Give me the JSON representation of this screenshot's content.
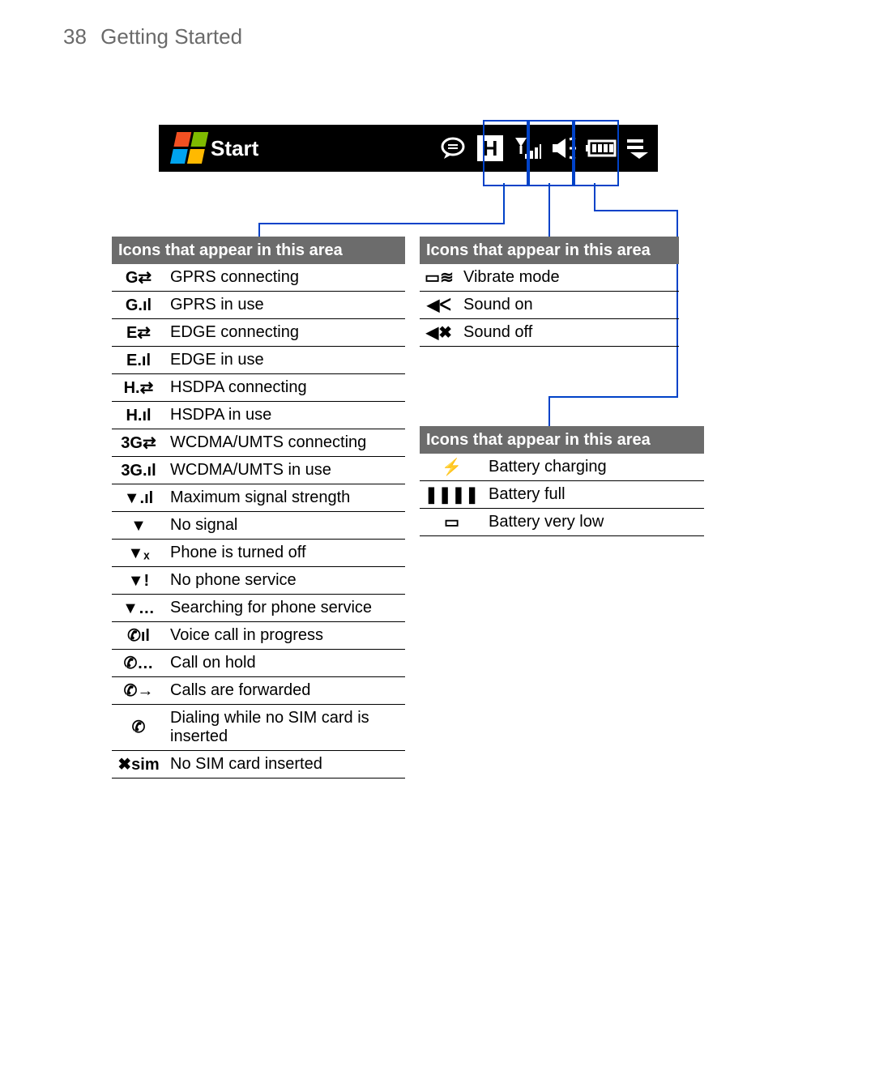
{
  "header": {
    "page_number": "38",
    "section": "Getting Started"
  },
  "statusbar": {
    "start_label": "Start",
    "icons": [
      "chat-icon",
      "hsdpa-icon",
      "signal-icon",
      "sound-icon",
      "battery-icon",
      "menu-icon"
    ]
  },
  "callout": {
    "blue": "#0042c8"
  },
  "tables": {
    "signal": {
      "title": "Icons that appear in this area",
      "rows": [
        {
          "icon": "G⇄",
          "label": "GPRS connecting"
        },
        {
          "icon": "G.ıl",
          "label": "GPRS in use"
        },
        {
          "icon": "E⇄",
          "label": "EDGE connecting"
        },
        {
          "icon": "E.ıl",
          "label": "EDGE in use"
        },
        {
          "icon": "H.⇄",
          "label": "HSDPA connecting"
        },
        {
          "icon": "H.ıl",
          "label": "HSDPA in use"
        },
        {
          "icon": "3G⇄",
          "label": "WCDMA/UMTS connecting"
        },
        {
          "icon": "3G.ıl",
          "label": "WCDMA/UMTS in use"
        },
        {
          "icon": "▼.ıl",
          "label": "Maximum signal strength"
        },
        {
          "icon": "▼",
          "label": "No signal"
        },
        {
          "icon": "▼ₓ",
          "label": "Phone is turned off"
        },
        {
          "icon": "▼!",
          "label": "No phone service"
        },
        {
          "icon": "▼…",
          "label": "Searching for phone service"
        },
        {
          "icon": "✆ıl",
          "label": "Voice call in progress"
        },
        {
          "icon": "✆…",
          "label": "Call on hold"
        },
        {
          "icon": "✆→",
          "label": "Calls are forwarded"
        },
        {
          "icon": "✆",
          "label": "Dialing while no SIM card is inserted"
        },
        {
          "icon": "✖sim",
          "label": "No SIM card inserted"
        }
      ]
    },
    "sound": {
      "title": "Icons that appear in this area",
      "rows": [
        {
          "icon": "▭≋",
          "label": "Vibrate mode"
        },
        {
          "icon": "◀ᐸ",
          "label": "Sound on"
        },
        {
          "icon": "◀✖",
          "label": "Sound off"
        }
      ]
    },
    "battery": {
      "title": "Icons that appear in this area",
      "rows": [
        {
          "icon": "⚡",
          "label": "Battery charging"
        },
        {
          "icon": "❚❚❚❚",
          "label": "Battery full"
        },
        {
          "icon": "▭",
          "label": "Battery very low"
        }
      ]
    }
  }
}
